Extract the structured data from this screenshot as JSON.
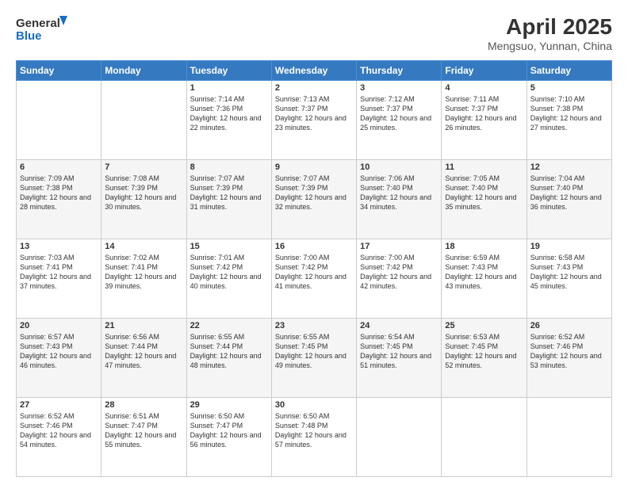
{
  "logo": {
    "line1": "General",
    "line2": "Blue"
  },
  "title": "April 2025",
  "subtitle": "Mengsuo, Yunnan, China",
  "days_of_week": [
    "Sunday",
    "Monday",
    "Tuesday",
    "Wednesday",
    "Thursday",
    "Friday",
    "Saturday"
  ],
  "weeks": [
    [
      {
        "num": "",
        "sunrise": "",
        "sunset": "",
        "daylight": ""
      },
      {
        "num": "",
        "sunrise": "",
        "sunset": "",
        "daylight": ""
      },
      {
        "num": "1",
        "sunrise": "Sunrise: 7:14 AM",
        "sunset": "Sunset: 7:36 PM",
        "daylight": "Daylight: 12 hours and 22 minutes."
      },
      {
        "num": "2",
        "sunrise": "Sunrise: 7:13 AM",
        "sunset": "Sunset: 7:37 PM",
        "daylight": "Daylight: 12 hours and 23 minutes."
      },
      {
        "num": "3",
        "sunrise": "Sunrise: 7:12 AM",
        "sunset": "Sunset: 7:37 PM",
        "daylight": "Daylight: 12 hours and 25 minutes."
      },
      {
        "num": "4",
        "sunrise": "Sunrise: 7:11 AM",
        "sunset": "Sunset: 7:37 PM",
        "daylight": "Daylight: 12 hours and 26 minutes."
      },
      {
        "num": "5",
        "sunrise": "Sunrise: 7:10 AM",
        "sunset": "Sunset: 7:38 PM",
        "daylight": "Daylight: 12 hours and 27 minutes."
      }
    ],
    [
      {
        "num": "6",
        "sunrise": "Sunrise: 7:09 AM",
        "sunset": "Sunset: 7:38 PM",
        "daylight": "Daylight: 12 hours and 28 minutes."
      },
      {
        "num": "7",
        "sunrise": "Sunrise: 7:08 AM",
        "sunset": "Sunset: 7:39 PM",
        "daylight": "Daylight: 12 hours and 30 minutes."
      },
      {
        "num": "8",
        "sunrise": "Sunrise: 7:07 AM",
        "sunset": "Sunset: 7:39 PM",
        "daylight": "Daylight: 12 hours and 31 minutes."
      },
      {
        "num": "9",
        "sunrise": "Sunrise: 7:07 AM",
        "sunset": "Sunset: 7:39 PM",
        "daylight": "Daylight: 12 hours and 32 minutes."
      },
      {
        "num": "10",
        "sunrise": "Sunrise: 7:06 AM",
        "sunset": "Sunset: 7:40 PM",
        "daylight": "Daylight: 12 hours and 34 minutes."
      },
      {
        "num": "11",
        "sunrise": "Sunrise: 7:05 AM",
        "sunset": "Sunset: 7:40 PM",
        "daylight": "Daylight: 12 hours and 35 minutes."
      },
      {
        "num": "12",
        "sunrise": "Sunrise: 7:04 AM",
        "sunset": "Sunset: 7:40 PM",
        "daylight": "Daylight: 12 hours and 36 minutes."
      }
    ],
    [
      {
        "num": "13",
        "sunrise": "Sunrise: 7:03 AM",
        "sunset": "Sunset: 7:41 PM",
        "daylight": "Daylight: 12 hours and 37 minutes."
      },
      {
        "num": "14",
        "sunrise": "Sunrise: 7:02 AM",
        "sunset": "Sunset: 7:41 PM",
        "daylight": "Daylight: 12 hours and 39 minutes."
      },
      {
        "num": "15",
        "sunrise": "Sunrise: 7:01 AM",
        "sunset": "Sunset: 7:42 PM",
        "daylight": "Daylight: 12 hours and 40 minutes."
      },
      {
        "num": "16",
        "sunrise": "Sunrise: 7:00 AM",
        "sunset": "Sunset: 7:42 PM",
        "daylight": "Daylight: 12 hours and 41 minutes."
      },
      {
        "num": "17",
        "sunrise": "Sunrise: 7:00 AM",
        "sunset": "Sunset: 7:42 PM",
        "daylight": "Daylight: 12 hours and 42 minutes."
      },
      {
        "num": "18",
        "sunrise": "Sunrise: 6:59 AM",
        "sunset": "Sunset: 7:43 PM",
        "daylight": "Daylight: 12 hours and 43 minutes."
      },
      {
        "num": "19",
        "sunrise": "Sunrise: 6:58 AM",
        "sunset": "Sunset: 7:43 PM",
        "daylight": "Daylight: 12 hours and 45 minutes."
      }
    ],
    [
      {
        "num": "20",
        "sunrise": "Sunrise: 6:57 AM",
        "sunset": "Sunset: 7:43 PM",
        "daylight": "Daylight: 12 hours and 46 minutes."
      },
      {
        "num": "21",
        "sunrise": "Sunrise: 6:56 AM",
        "sunset": "Sunset: 7:44 PM",
        "daylight": "Daylight: 12 hours and 47 minutes."
      },
      {
        "num": "22",
        "sunrise": "Sunrise: 6:55 AM",
        "sunset": "Sunset: 7:44 PM",
        "daylight": "Daylight: 12 hours and 48 minutes."
      },
      {
        "num": "23",
        "sunrise": "Sunrise: 6:55 AM",
        "sunset": "Sunset: 7:45 PM",
        "daylight": "Daylight: 12 hours and 49 minutes."
      },
      {
        "num": "24",
        "sunrise": "Sunrise: 6:54 AM",
        "sunset": "Sunset: 7:45 PM",
        "daylight": "Daylight: 12 hours and 51 minutes."
      },
      {
        "num": "25",
        "sunrise": "Sunrise: 6:53 AM",
        "sunset": "Sunset: 7:45 PM",
        "daylight": "Daylight: 12 hours and 52 minutes."
      },
      {
        "num": "26",
        "sunrise": "Sunrise: 6:52 AM",
        "sunset": "Sunset: 7:46 PM",
        "daylight": "Daylight: 12 hours and 53 minutes."
      }
    ],
    [
      {
        "num": "27",
        "sunrise": "Sunrise: 6:52 AM",
        "sunset": "Sunset: 7:46 PM",
        "daylight": "Daylight: 12 hours and 54 minutes."
      },
      {
        "num": "28",
        "sunrise": "Sunrise: 6:51 AM",
        "sunset": "Sunset: 7:47 PM",
        "daylight": "Daylight: 12 hours and 55 minutes."
      },
      {
        "num": "29",
        "sunrise": "Sunrise: 6:50 AM",
        "sunset": "Sunset: 7:47 PM",
        "daylight": "Daylight: 12 hours and 56 minutes."
      },
      {
        "num": "30",
        "sunrise": "Sunrise: 6:50 AM",
        "sunset": "Sunset: 7:48 PM",
        "daylight": "Daylight: 12 hours and 57 minutes."
      },
      {
        "num": "",
        "sunrise": "",
        "sunset": "",
        "daylight": ""
      },
      {
        "num": "",
        "sunrise": "",
        "sunset": "",
        "daylight": ""
      },
      {
        "num": "",
        "sunrise": "",
        "sunset": "",
        "daylight": ""
      }
    ]
  ]
}
